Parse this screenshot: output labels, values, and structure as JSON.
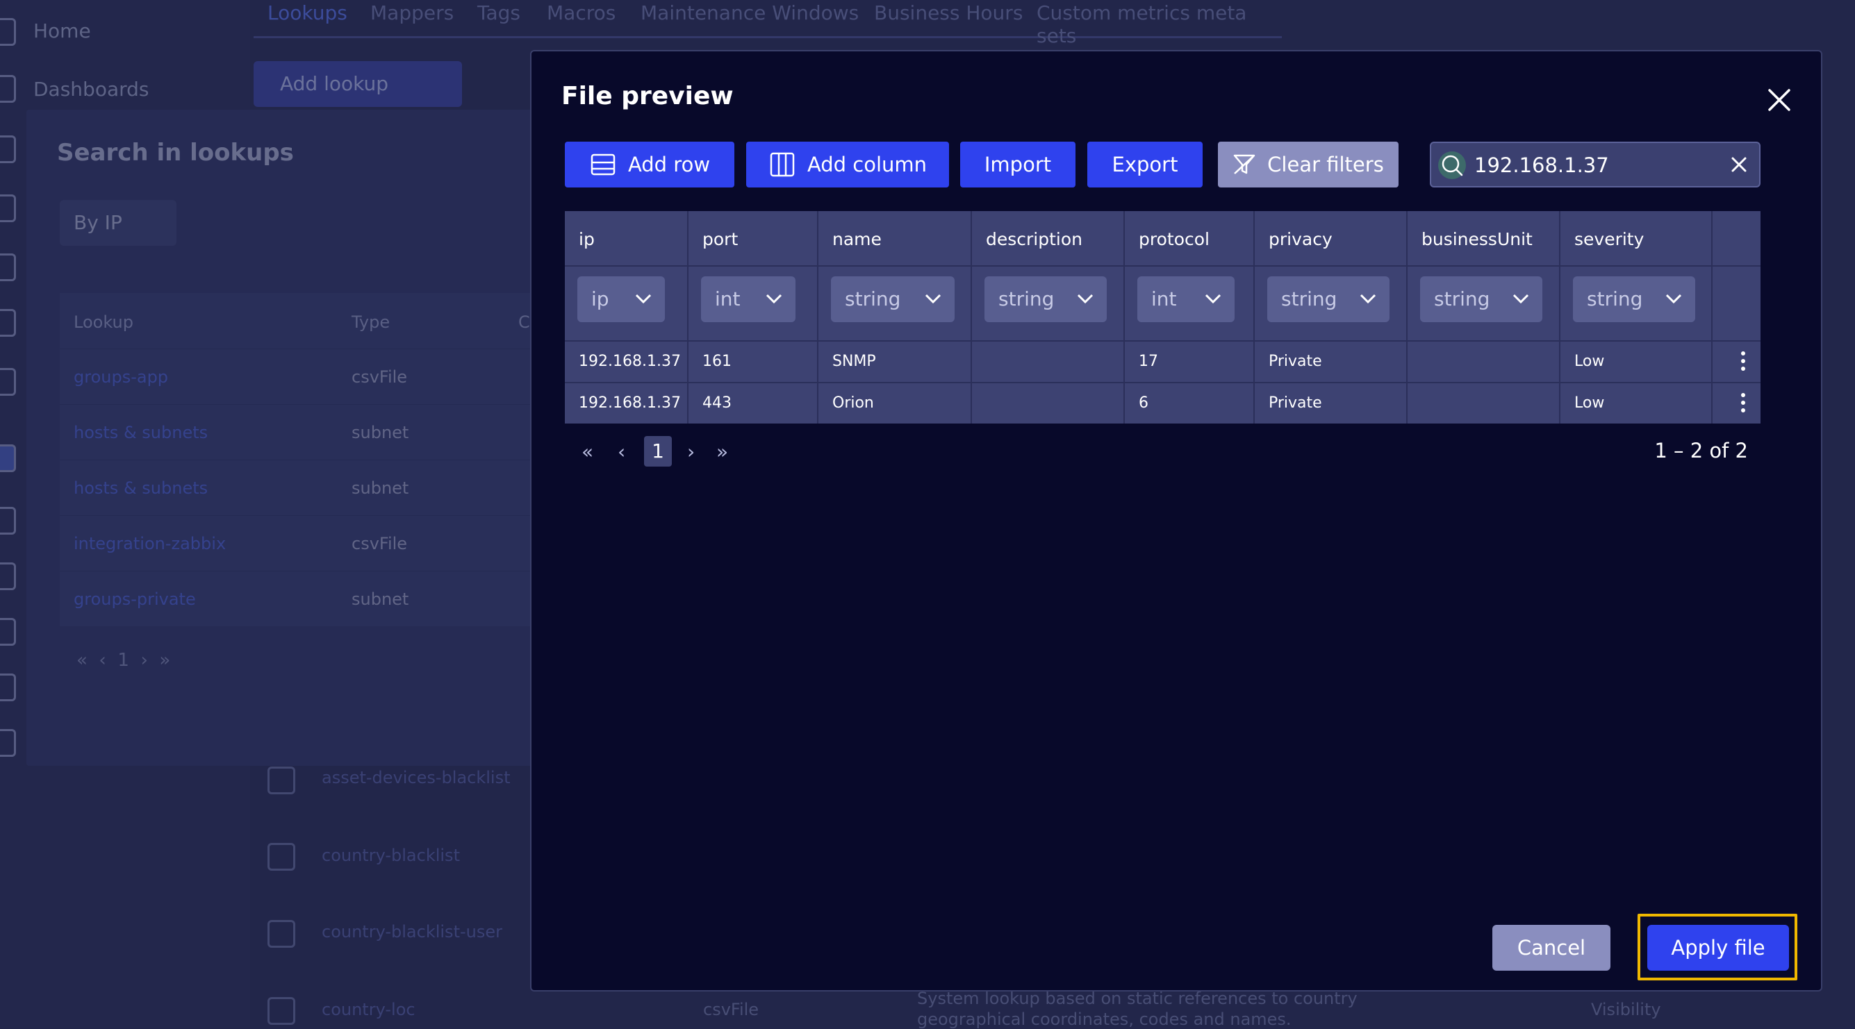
{
  "background": {
    "nav": [
      "Home",
      "Dashboards"
    ],
    "tabs": [
      "Lookups",
      "Mappers",
      "Tags",
      "Macros",
      "Maintenance Windows",
      "Business Hours",
      "Custom metrics meta sets"
    ],
    "add_lookup": "Add lookup",
    "search_title": "Search in lookups",
    "search_by": "By IP",
    "table_headers": [
      "Lookup",
      "Type",
      "C"
    ],
    "table_rows": [
      {
        "lookup": "groups-app",
        "type": "csvFile"
      },
      {
        "lookup": "hosts & subnets",
        "type": "subnet"
      },
      {
        "lookup": "hosts & subnets",
        "type": "subnet"
      },
      {
        "lookup": "integration-zabbix",
        "type": "csvFile"
      },
      {
        "lookup": "groups-private",
        "type": "subnet"
      }
    ],
    "page": "1",
    "lower_rows": [
      "asset-devices-blacklist",
      "country-blacklist",
      "country-blacklist-user",
      "country-loc"
    ],
    "bottom_type": "csvFile",
    "bottom_desc_1": "System lookup based on static references to country",
    "bottom_desc_2": "geographical coordinates, codes and names.",
    "bottom_tag": "Visibility"
  },
  "modal": {
    "title": "File preview",
    "toolbar": {
      "add_row": "Add row",
      "add_column": "Add column",
      "import": "Import",
      "export": "Export",
      "clear_filters": "Clear filters"
    },
    "search": {
      "value": "192.168.1.37"
    },
    "columns": [
      {
        "name": "ip",
        "type": "ip"
      },
      {
        "name": "port",
        "type": "int"
      },
      {
        "name": "name",
        "type": "string"
      },
      {
        "name": "description",
        "type": "string"
      },
      {
        "name": "protocol",
        "type": "int"
      },
      {
        "name": "privacy",
        "type": "string"
      },
      {
        "name": "businessUnit",
        "type": "string"
      },
      {
        "name": "severity",
        "type": "string"
      }
    ],
    "rows": [
      [
        "192.168.1.37",
        "161",
        "SNMP",
        "",
        "17",
        "Private",
        "",
        "Low"
      ],
      [
        "192.168.1.37",
        "443",
        "Orion",
        "",
        "6",
        "Private",
        "",
        "Low"
      ]
    ],
    "pager": {
      "page": "1",
      "range": "1 – 2 of 2"
    },
    "cancel": "Cancel",
    "apply": "Apply file"
  }
}
